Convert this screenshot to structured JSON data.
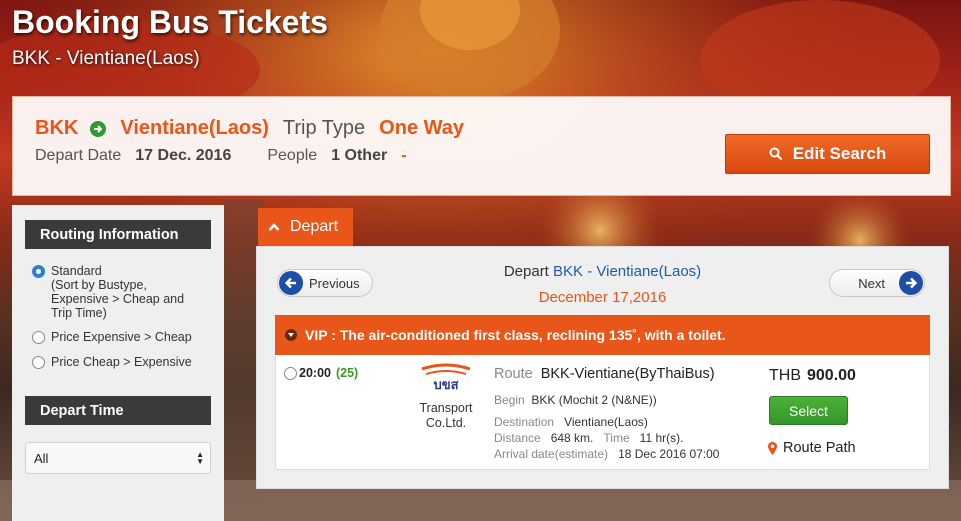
{
  "hero": {
    "title": "Booking Bus Tickets",
    "subtitle": "BKK - Vientiane(Laos)"
  },
  "search": {
    "origin": "BKK",
    "destination": "Vientiane(Laos)",
    "trip_type_label": "Trip Type",
    "trip_type_value": "One Way",
    "depart_date_label": "Depart Date",
    "depart_date_value": "17 Dec. 2016",
    "people_label": "People",
    "people_value": "1 Other",
    "people_suffix": "-",
    "edit_button": "Edit Search"
  },
  "sidebar": {
    "routing_header": "Routing Information",
    "options": [
      {
        "label": "Standard",
        "detail": "(Sort by Bustype, Expensive > Cheap and Trip Time)",
        "checked": true
      },
      {
        "label": "Price Expensive > Cheap",
        "checked": false
      },
      {
        "label": "Price Cheap > Expensive",
        "checked": false
      }
    ],
    "depart_time_header": "Depart Time",
    "depart_time_selected": "All"
  },
  "results": {
    "tab_label": "Depart",
    "previous_label": "Previous",
    "next_label": "Next",
    "heading_prefix": "Depart",
    "heading_route": "BKK - Vientiane(Laos)",
    "heading_date": "December 17,2016",
    "class_banner": "VIP : The air-conditioned first class, reclining 135˚, with a toilet.",
    "trip": {
      "time": "20:00",
      "seats": "(25)",
      "company_line1": "Transport",
      "company_line2": "Co.Ltd.",
      "route_label": "Route",
      "route_value": "BKK-Vientiane(ByThaiBus)",
      "begin_label": "Begin",
      "begin_value": "BKK (Mochit 2 (N&NE))",
      "destination_label": "Destination",
      "destination_value": "Vientiane(Laos)",
      "distance_label": "Distance",
      "distance_value": "648 km.",
      "time_label": "Time",
      "time_value": "11 hr(s).",
      "arrival_label": "Arrival date(estimate)",
      "arrival_value": "18 Dec 2016 07:00",
      "currency": "THB",
      "price": "900.00",
      "select_label": "Select",
      "route_path_label": "Route Path"
    }
  },
  "colors": {
    "accent_orange": "#e8561a",
    "link_blue": "#1a5ea8",
    "select_green": "#3aa32e",
    "header_dark": "#3a3a3a"
  }
}
